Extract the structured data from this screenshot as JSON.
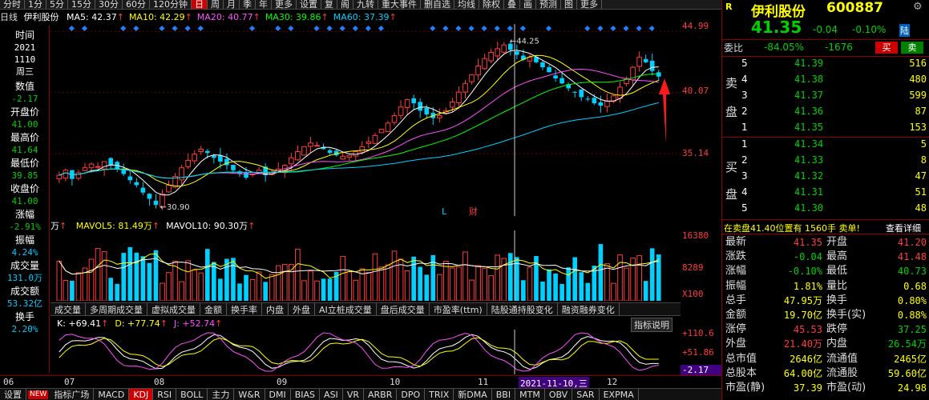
{
  "toolbar": {
    "items": [
      "分时",
      "1分",
      "5分",
      "15分",
      "30分",
      "60分",
      "120分钟",
      "日",
      "周",
      "月",
      "季",
      "年",
      "更多",
      "设置",
      "复",
      "阁",
      "九转",
      "重大事件",
      "删自选",
      "均线",
      "除权",
      "叠",
      "画",
      "预测",
      "图",
      "更多"
    ],
    "active_index": 7
  },
  "ma_line": {
    "kind": "日线",
    "stock": "伊利股份",
    "items": [
      {
        "label": "MA5: 42.37",
        "color": "#ffffff"
      },
      {
        "label": "MA10: 42.29",
        "color": "#ffff00"
      },
      {
        "label": "MA20: 40.77",
        "color": "#ff50ff"
      },
      {
        "label": "MA30: 39.86",
        "color": "#00ff00"
      },
      {
        "label": "MA60: 37.39",
        "color": "#00d0ff"
      }
    ]
  },
  "info": [
    {
      "label": "时间",
      "value": "2021",
      "value2": "1110",
      "value3": "周三",
      "color": "#ffffff"
    },
    {
      "label": "数值",
      "value": "-2.17",
      "color": "#00d000"
    },
    {
      "label": "开盘价",
      "value": "41.00",
      "color": "#00d000"
    },
    {
      "label": "最高价",
      "value": "41.64",
      "color": "#00d000"
    },
    {
      "label": "最低价",
      "value": "39.85",
      "color": "#00d000"
    },
    {
      "label": "收盘价",
      "value": "41.00",
      "color": "#00d000"
    },
    {
      "label": "涨幅",
      "value": "-2.91%",
      "color": "#00d000"
    },
    {
      "label": "振幅",
      "value": "4.24%",
      "color": "#0cf"
    },
    {
      "label": "成交量",
      "value": "131.0万",
      "color": "#0cf"
    },
    {
      "label": "成交额",
      "value": "53.32亿",
      "color": "#0cf"
    },
    {
      "label": "换手",
      "value": "2.20%",
      "color": "#0cf"
    }
  ],
  "price_axis": {
    "labels": [
      "44.99",
      "40.07",
      "35.14"
    ]
  },
  "vol_axis": {
    "labels": [
      "16380",
      "8289",
      "X100"
    ]
  },
  "kdj_axis": {
    "labels": [
      "+110.6",
      "+51.86",
      "-2.17"
    ]
  },
  "annotations": {
    "high_label": "44.25",
    "low_label": "30.90",
    "l_mark": "L",
    "cai_mark": "财"
  },
  "volume_line": {
    "prefix": "万",
    "items": [
      {
        "label": "MAVOL5: 81.49万",
        "color": "#ffff00"
      },
      {
        "label": "MAVOL10: 90.30万",
        "color": "#ffffff"
      }
    ]
  },
  "vol_tabs": [
    "成交量",
    "多周期成交量",
    "虚拟成交量",
    "金额",
    "换手率",
    "内盘",
    "外盘",
    "AI立桩成交量",
    "盘后成交量",
    "市盈率(ttm)",
    "陆股通持股变化",
    "融资融券变化"
  ],
  "kdj_line": {
    "items": [
      {
        "label": "K: +69.41",
        "color": "#ffffff"
      },
      {
        "label": "D: +77.74",
        "color": "#ffff00"
      },
      {
        "label": "J: +52.74",
        "color": "#ff50ff"
      }
    ],
    "help": "指标说明"
  },
  "date_axis": {
    "labels": [
      "06",
      "07",
      "08",
      "09",
      "10",
      "11",
      "12"
    ],
    "cursor": "2021-11-10,三"
  },
  "bottom_tabs": [
    "设置",
    "指标广场",
    "MACD",
    "KDJ",
    "RSI",
    "BOLL",
    "主力",
    "W&R",
    "DMI",
    "BIAS",
    "ASI",
    "VR",
    "ARBR",
    "DPO",
    "TRIX",
    "新DMA",
    "BBI",
    "MTM",
    "OBV",
    "SAR",
    "EXPMA"
  ],
  "bottom_active": 3,
  "new_badge": "NEW",
  "quote": {
    "r_badge": "R",
    "name": "伊利股份",
    "code": "600887",
    "price": "41.35",
    "change": "-0.04",
    "pct": "-0.10%",
    "market": "陆",
    "weibi_label": "委比",
    "weibi": "-84.05%",
    "weicha": "-1676",
    "buy_btn": "买",
    "sell_btn": "卖",
    "sell_side_label": [
      "卖",
      "盘"
    ],
    "buy_side_label": [
      "买",
      "盘"
    ],
    "asks": [
      {
        "level": "5",
        "price": "41.39",
        "vol": "516"
      },
      {
        "level": "4",
        "price": "41.38",
        "vol": "480"
      },
      {
        "level": "3",
        "price": "41.37",
        "vol": "599"
      },
      {
        "level": "2",
        "price": "41.36",
        "vol": "87"
      },
      {
        "level": "1",
        "price": "41.35",
        "vol": "153"
      }
    ],
    "bids": [
      {
        "level": "1",
        "price": "41.34",
        "vol": "5"
      },
      {
        "level": "2",
        "price": "41.33",
        "vol": "8"
      },
      {
        "level": "3",
        "price": "41.32",
        "vol": "47"
      },
      {
        "level": "4",
        "price": "41.31",
        "vol": "51"
      },
      {
        "level": "5",
        "price": "41.30",
        "vol": "48"
      }
    ],
    "notice": "在卖盘41.40位置有 1560手 卖单!",
    "notice_link": "查看详细",
    "stats": [
      [
        "最新",
        "41.35",
        "#ff3c3c",
        "开盘",
        "41.20",
        "#ff3c3c"
      ],
      [
        "涨跌",
        "-0.04",
        "#00d000",
        "最高",
        "41.48",
        "#ff3c3c"
      ],
      [
        "涨幅",
        "-0.10%",
        "#00d000",
        "最低",
        "40.73",
        "#00d000"
      ],
      [
        "振幅",
        "1.81%",
        "#ffff00",
        "量比",
        "0.68",
        "#ffff00"
      ],
      [
        "总手",
        "47.95万",
        "#ffff00",
        "换手",
        "0.80%",
        "#ffff00"
      ],
      [
        "金额",
        "19.70亿",
        "#ffff00",
        "换手(实)",
        "0.88%",
        "#ffff00"
      ],
      [
        "涨停",
        "45.53",
        "#ff3c3c",
        "跌停",
        "37.25",
        "#00d000"
      ],
      [
        "外盘",
        "21.40万",
        "#ff3c3c",
        "内盘",
        "26.54万",
        "#00d000"
      ],
      [
        "总市值",
        "2646亿",
        "#ffff00",
        "流通值",
        "2465亿",
        "#ffff00"
      ],
      [
        "总股本",
        "64.00亿",
        "#ffff00",
        "流通股",
        "59.60亿",
        "#ffff00"
      ],
      [
        "市盈(静)",
        "37.39",
        "#ffff00",
        "市盈(动)",
        "24.98",
        "#ffff00"
      ]
    ]
  },
  "chart_data": {
    "type": "candlestick",
    "closes": [
      33.4,
      33.8,
      33.1,
      33.6,
      34.0,
      34.3,
      34.1,
      34.5,
      34.2,
      33.9,
      33.5,
      33.0,
      32.6,
      32.0,
      31.5,
      31.0,
      31.9,
      32.6,
      33.3,
      34.0,
      34.6,
      35.1,
      35.5,
      35.2,
      34.8,
      34.5,
      34.2,
      33.8,
      33.5,
      33.2,
      33.5,
      33.8,
      33.4,
      33.6,
      33.9,
      34.2,
      34.8,
      35.3,
      35.7,
      36.0,
      35.8,
      35.5,
      35.2,
      35.0,
      34.9,
      35.0,
      35.3,
      35.7,
      36.1,
      36.6,
      37.1,
      37.6,
      38.2,
      38.9,
      39.5,
      39.2,
      38.6,
      38.3,
      38.0,
      38.2,
      38.6,
      39.3,
      40.1,
      40.8,
      41.5,
      42.2,
      42.8,
      43.3,
      43.6,
      43.9,
      43.5,
      43.1,
      42.7,
      42.9,
      42.5,
      42.1,
      41.7,
      41.2,
      40.8,
      40.4,
      40.1,
      39.7,
      39.5,
      39.2,
      39.0,
      39.4,
      39.8,
      40.5,
      41.2,
      42.1,
      42.9,
      42.5,
      41.8,
      41.35
    ],
    "ylim": [
      30.5,
      45.2
    ]
  }
}
